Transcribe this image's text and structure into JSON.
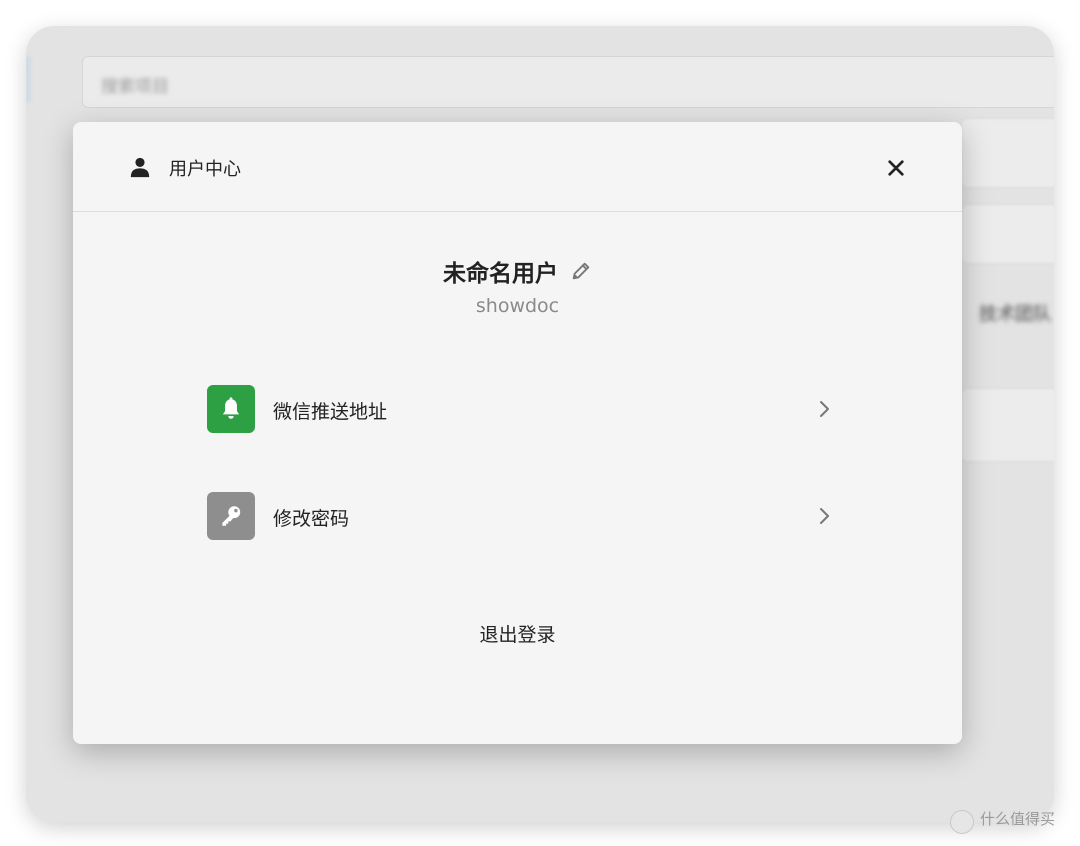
{
  "background": {
    "search_placeholder": "搜索项目",
    "side_text": "技术团队",
    "footer_text": "什么值得买"
  },
  "modal": {
    "title": "用户中心",
    "header_icon": "user-icon",
    "close_icon": "close-icon",
    "username": "未命名用户",
    "edit_icon": "pencil-icon",
    "account": "showdoc",
    "menu": [
      {
        "label": "微信推送地址",
        "icon": "bell-icon",
        "icon_bg": "#2ea044"
      },
      {
        "label": "修改密码",
        "icon": "key-icon",
        "icon_bg": "#8e8e8e"
      }
    ],
    "logout_label": "退出登录"
  },
  "colors": {
    "modal_bg": "#f5f5f5",
    "bell_green": "#2ea044",
    "key_gray": "#8e8e8e"
  }
}
